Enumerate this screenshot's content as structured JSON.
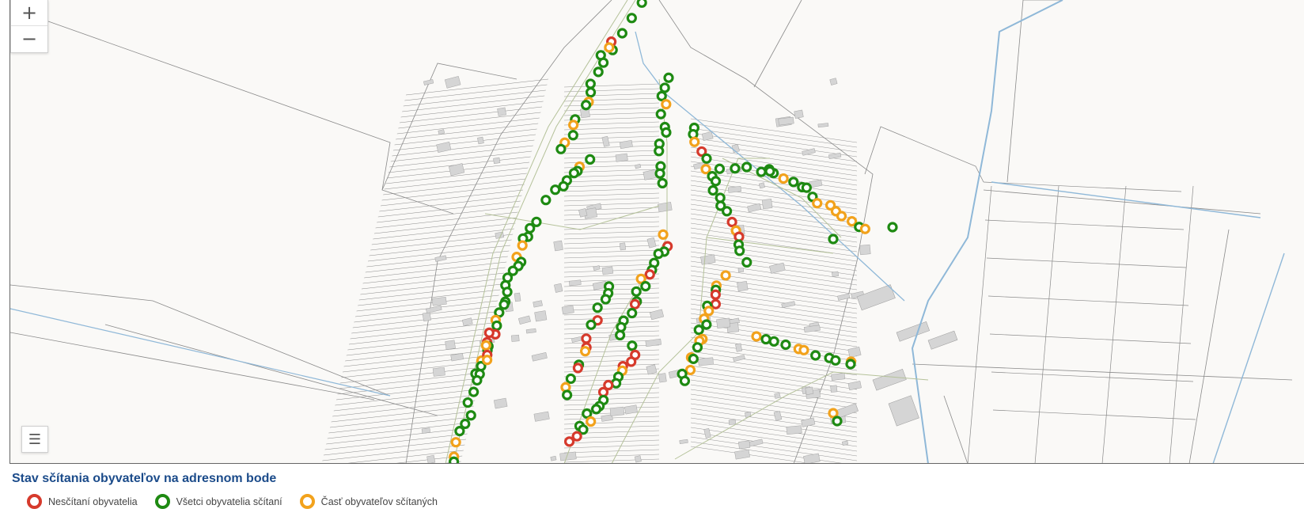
{
  "map": {
    "zoom_in_label": "+",
    "zoom_out_label": "−",
    "layers_label": "☰"
  },
  "legend": {
    "title": "Stav sčítania obyvateľov na adresnom bode",
    "items": [
      {
        "label": "Nesčítaní obyvatelia",
        "color": "#d63a2c"
      },
      {
        "label": "Všetci obyvatelia sčítaní",
        "color": "#1e8a12"
      },
      {
        "label": "Časť obyvateľov sčítaných",
        "color": "#f2a21c"
      }
    ]
  },
  "colors": {
    "background": "#faf9f7",
    "parcel_line": "#8a8a8a",
    "building_fill": "#d5d5d5",
    "water": "#8fb8d8",
    "road_edge": "#b5c29a"
  }
}
